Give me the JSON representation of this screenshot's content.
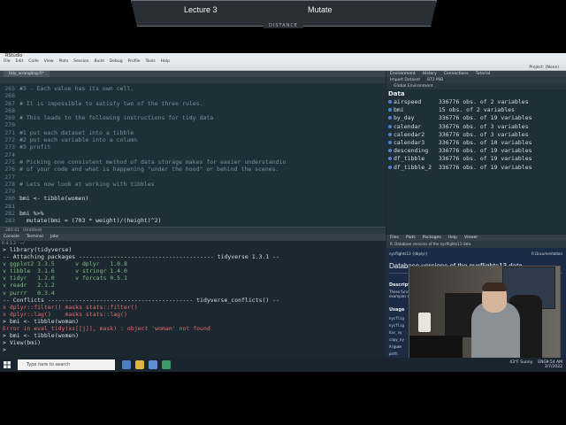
{
  "window": {
    "title": "RStudio",
    "project": "Project: (None)"
  },
  "menu": [
    "File",
    "Edit",
    "Code",
    "View",
    "Plots",
    "Session",
    "Build",
    "Debug",
    "Profile",
    "Tools",
    "Help"
  ],
  "banner": {
    "left": "Lecture 3",
    "right": "Mutate",
    "sub": "DISTANCE"
  },
  "editor": {
    "tab": "tidy_wrangling.R*",
    "status": {
      "position": "283:41",
      "scope": "(Untitled)"
    },
    "lines": [
      {
        "n": "265",
        "code": "#3 - Each value has its own cell.",
        "comment": true
      },
      {
        "n": "266",
        "code": "",
        "comment": false
      },
      {
        "n": "267",
        "code": "# It is impossible to satisfy two of the three rules.",
        "comment": true
      },
      {
        "n": "268",
        "code": "",
        "comment": false
      },
      {
        "n": "269",
        "code": "# This leads to the following instructions for tidy data",
        "comment": true
      },
      {
        "n": "270",
        "code": "",
        "comment": false
      },
      {
        "n": "271",
        "code": "#1 put each dataset into a tibble",
        "comment": true
      },
      {
        "n": "272",
        "code": "#2 put each variable into a column",
        "comment": true
      },
      {
        "n": "273",
        "code": "#3 profit",
        "comment": true
      },
      {
        "n": "274",
        "code": "",
        "comment": false
      },
      {
        "n": "275",
        "code": "# Picking one consistent method of data storage makes for easier understandin",
        "comment": true
      },
      {
        "n": "276",
        "code": "# of your code and what is happening \"under the hood\" or behind the scenes.",
        "comment": true
      },
      {
        "n": "277",
        "code": "",
        "comment": false
      },
      {
        "n": "278",
        "code": "# Lets now look at working with tibbles",
        "comment": true
      },
      {
        "n": "279",
        "code": "",
        "comment": false
      },
      {
        "n": "280",
        "code": "bmi <- tibble(women)",
        "comment": false
      },
      {
        "n": "281",
        "code": "",
        "comment": false
      },
      {
        "n": "282",
        "code": "bmi %>%",
        "comment": false
      },
      {
        "n": "283",
        "code": "  mutate(bmi = (703 * weight)/(height)^2)",
        "comment": false
      }
    ]
  },
  "console": {
    "tabs": [
      "Console",
      "Terminal",
      "Jobs"
    ],
    "path": "R 4.1.2 · ~/",
    "lines": [
      {
        "t": "> library(tidyverse)",
        "k": "hdr"
      },
      {
        "t": "-- Attaching packages --------------------------------------- tidyverse 1.3.1 --",
        "k": "hdr"
      },
      {
        "t": "v ggplot2 3.3.5      v dplyr   1.0.8",
        "k": "ok"
      },
      {
        "t": "v tibble  3.1.6      v stringr 1.4.0",
        "k": "ok"
      },
      {
        "t": "v tidyr   1.2.0      v forcats 0.5.1",
        "k": "ok"
      },
      {
        "t": "v readr   2.1.2",
        "k": "ok"
      },
      {
        "t": "v purrr   0.3.4",
        "k": "ok"
      },
      {
        "t": "-- Conflicts ------------------------------------------ tidyverse_conflicts() --",
        "k": "hdr"
      },
      {
        "t": "x dplyr::filter() masks stats::filter()",
        "k": "err"
      },
      {
        "t": "x dplyr::lag()    masks stats::lag()",
        "k": "err"
      },
      {
        "t": "> bmi <- tibble(woman)",
        "k": "hdr"
      },
      {
        "t": "Error in eval_tidy(xs[[j]], mask) : object 'woman' not found",
        "k": "err"
      },
      {
        "t": "> bmi <- tibble(women)",
        "k": "hdr"
      },
      {
        "t": "> View(bmi)",
        "k": "hdr"
      },
      {
        "t": ">",
        "k": "hdr"
      }
    ]
  },
  "environment": {
    "tabs": [
      "Environment",
      "History",
      "Connections",
      "Tutorial"
    ],
    "toolbar": [
      "Import Dataset",
      "872 MiB"
    ],
    "scope": "Global Environment",
    "heading": "Data",
    "rows": [
      {
        "name": "airspeed",
        "desc": "336776 obs. of 2 variables"
      },
      {
        "name": "bmi",
        "desc": "15 obs. of 2 variables"
      },
      {
        "name": "by_day",
        "desc": "336776 obs. of 19 variables"
      },
      {
        "name": "calendar",
        "desc": "336776 obs. of 3 variables"
      },
      {
        "name": "calendar2",
        "desc": "336776 obs. of 3 variables"
      },
      {
        "name": "calendar3",
        "desc": "336776 obs. of 10 variables"
      },
      {
        "name": "descending",
        "desc": "336776 obs. of 19 variables"
      },
      {
        "name": "df_tibble",
        "desc": "336776 obs. of 19 variables"
      },
      {
        "name": "df_tibble_2",
        "desc": "336776 obs. of 19 variables"
      }
    ]
  },
  "help": {
    "tabs": [
      "Files",
      "Plots",
      "Packages",
      "Help",
      "Viewer"
    ],
    "toolbar": "R: Database versions of the nycflights13 data",
    "crumb": "nycflights13 {dbplyr}",
    "doc_label": "R Documentation",
    "title": "Database versions of the nycflights13 data",
    "description_heading": "Description",
    "description": "These functions cache the data from the nycflights13 database in a local database, for use in examples and vignettes. Indexes are created to making joining tables on natural keys efficient.",
    "usage_heading": "Usage",
    "fragments": [
      "nycflig",
      "nycflig",
      "has_ny",
      "copy_ny",
      "Argume",
      "path",
      "sqlite",
      "dbonly"
    ]
  },
  "taskbar": {
    "search_placeholder": "Type here to search",
    "tray": [
      "43°F Sunny",
      "ENG"
    ],
    "time": "9:54 AM",
    "date": "3/7/2022"
  },
  "colors": {
    "accent": "#4b86c6",
    "error": "#e86a6a",
    "ok": "#7fbf7f"
  }
}
